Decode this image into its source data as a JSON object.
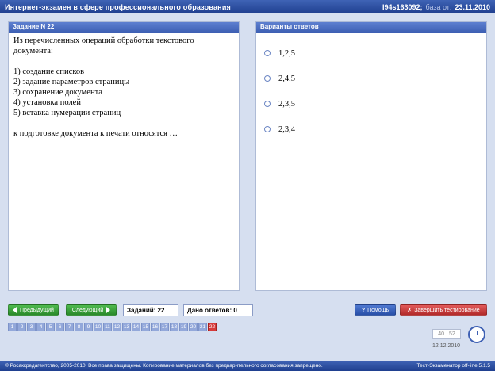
{
  "titlebar": {
    "title": "Интернет-экзамен в сфере профессионального образования",
    "user_id": "I94s163092;",
    "base_label": "база от:",
    "base_date": "23.11.2010"
  },
  "question_panel": {
    "header": "Задание N 22",
    "intro": "Из перечисленных операций обработки текстового документа:",
    "items": [
      "1) создание списков",
      "2) задание параметров страницы",
      "3) сохранение документа",
      "4) установка полей",
      "5) вставка нумерации страниц"
    ],
    "prompt": "к подготовке документа к печати относятся …"
  },
  "answers_panel": {
    "header": "Варианты ответов",
    "options": [
      "1,2,5",
      "2,4,5",
      "2,3,5",
      "2,3,4"
    ]
  },
  "toolbar": {
    "prev_label": "Предыдущий",
    "next_label": "Следующий",
    "tasks_label": "Заданий: 22",
    "answered_label": "Дано ответов: 0",
    "help_label": "Помощь",
    "finish_label": "Завершить тестирование"
  },
  "navigation": {
    "items": [
      "1",
      "2",
      "3",
      "4",
      "5",
      "6",
      "7",
      "8",
      "9",
      "10",
      "11",
      "12",
      "13",
      "14",
      "15",
      "16",
      "17",
      "18",
      "19",
      "20",
      "21",
      "22"
    ],
    "active": "22"
  },
  "timer": {
    "minutes": "40",
    "seconds": "52"
  },
  "date": "12.12.2010",
  "footer": {
    "copyright": "© Росаккредагентство, 2005-2010. Все права защищены. Копирование материалов без предварительного согласования запрещено.",
    "version": "Тест-Экзаменатор off-line 5.1.5"
  },
  "colors": {
    "accent": "#3d5fb3",
    "active_question": "#d63a3a",
    "nav_button": "#2a8a2a",
    "finish_button": "#b22a2a"
  }
}
